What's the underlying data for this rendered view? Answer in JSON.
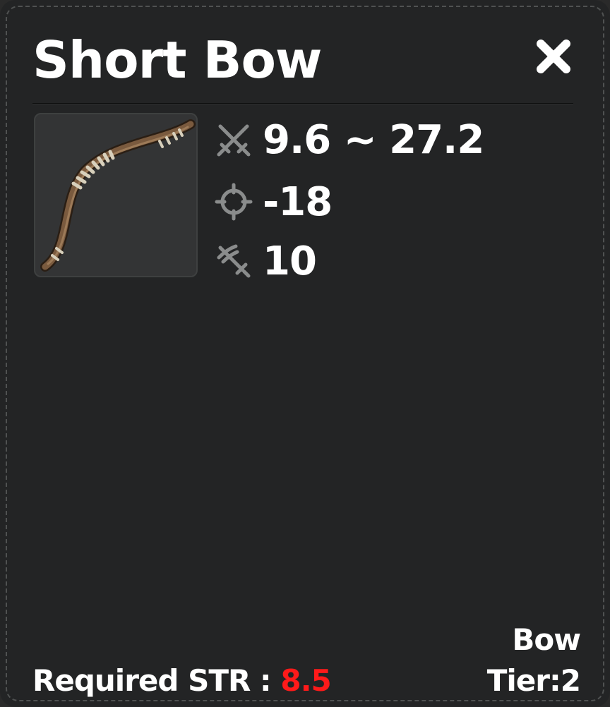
{
  "item": {
    "name": "Short Bow",
    "image": "short-bow-icon",
    "type": "Bow",
    "tier_prefix": "Tier:",
    "tier": "2"
  },
  "stats": [
    {
      "icon": "crossed-swords-icon",
      "value": "9.6 ~ 27.2"
    },
    {
      "icon": "crosshair-icon",
      "value": "-18"
    },
    {
      "icon": "sword-speed-icon",
      "value": "10"
    }
  ],
  "requirement": {
    "label": "Required STR : ",
    "value": "8.5",
    "value_color": "#ff1a1a"
  },
  "close_icon": "close-icon"
}
